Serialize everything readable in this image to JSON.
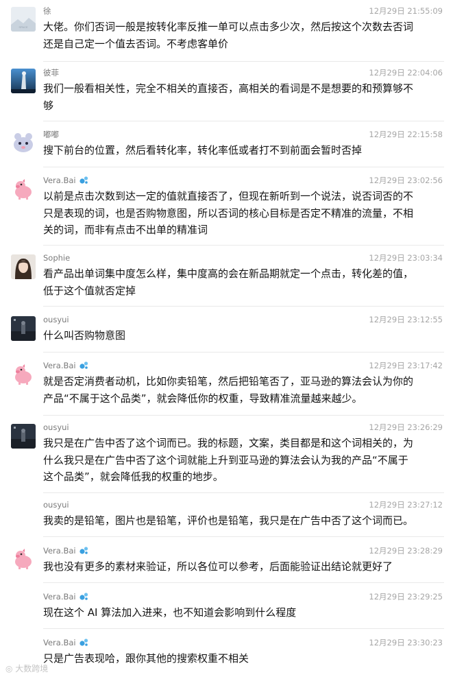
{
  "messages": [
    {
      "sender": "徐",
      "time": "12月29日 21:55:09",
      "text": "大佬。你们否词一般是按转化率反推一单可以点击多少次，然后按这个次数去否词\n还是自己定一个值去否词。不考虑客单价",
      "avatar": "landscape-avatar",
      "badge": false
    },
    {
      "sender": "彼菲",
      "time": "12月29日 22:04:06",
      "text": "我们一般看相关性，完全不相关的直接否，高相关的看词是不是想要的和预算够不\n够",
      "avatar": "statue-avatar",
      "badge": false
    },
    {
      "sender": "嘟嘟",
      "time": "12月29日 22:15:58",
      "text": "搜下前台的位置，然后看转化率，转化率低或者打不到前面会暂时否掉",
      "avatar": "cartoon-avatar",
      "badge": false
    },
    {
      "sender": "Vera.Bai",
      "time": "12月29日 23:02:56",
      "text": "以前是点击次数到达一定的值就直接否了，但现在新听到一个说法，说否词否的不\n只是表现的词，也是否购物意图，所以否词的核心目标是否定不精准的流量，不相\n关的词，而非有点击不出单的精准词",
      "avatar": "pig-avatar",
      "badge": true
    },
    {
      "sender": "Sophie",
      "time": "12月29日 23:03:34",
      "text": "看产品出单词集中度怎么样，集中度高的会在新品期就定一个点击，转化差的值，\n低于这个值就否定掉",
      "avatar": "girl-avatar",
      "badge": false
    },
    {
      "sender": "ousyui",
      "time": "12月29日 23:12:55",
      "text": "什么叫否购物意图",
      "avatar": "night-avatar",
      "badge": false
    },
    {
      "sender": "Vera.Bai",
      "time": "12月29日 23:17:42",
      "text": "就是否定消费者动机，比如你卖铅笔，然后把铅笔否了，亚马逊的算法会认为你的\n产品“不属于这个品类”，就会降低你的权重，导致精准流量越来越少。",
      "avatar": "pig-avatar",
      "badge": true
    },
    {
      "sender": "ousyui",
      "time": "12月29日 23:26:29",
      "text": "我只是在广告中否了这个词而已。我的标题，文案，类目都是和这个词相关的，为\n什么我只是在广告中否了这个词就能上升到亚马逊的算法会认为我的产品“不属于\n这个品类”，就会降低我的权重的地步。",
      "avatar": "night-avatar",
      "badge": false
    },
    {
      "sender": "ousyui",
      "time": "12月29日 23:27:12",
      "text": "我卖的是铅笔，图片也是铅笔，评价也是铅笔，我只是在广告中否了这个词而已。",
      "avatar": "",
      "badge": false
    },
    {
      "sender": "Vera.Bai",
      "time": "12月29日 23:28:29",
      "text": "我也没有更多的素材来验证，所以各位可以参考，后面能验证出结论就更好了",
      "avatar": "pig-avatar",
      "badge": true
    },
    {
      "sender": "Vera.Bai",
      "time": "12月29日 23:29:25",
      "text": "现在这个 AI 算法加入进来，也不知道会影响到什么程度",
      "avatar": "",
      "badge": true
    },
    {
      "sender": "Vera.Bai",
      "time": "12月29日 23:30:23",
      "text": "只是广告表现哈，跟你其他的搜索权重不相关",
      "avatar": "",
      "badge": true
    }
  ],
  "watermark": "大数跨境",
  "colors": {
    "sender": "#7a7a7a",
    "time": "#a6a6a6",
    "text": "#141414",
    "divider": "#e9e9e9",
    "badge": "#3aa0e0"
  }
}
